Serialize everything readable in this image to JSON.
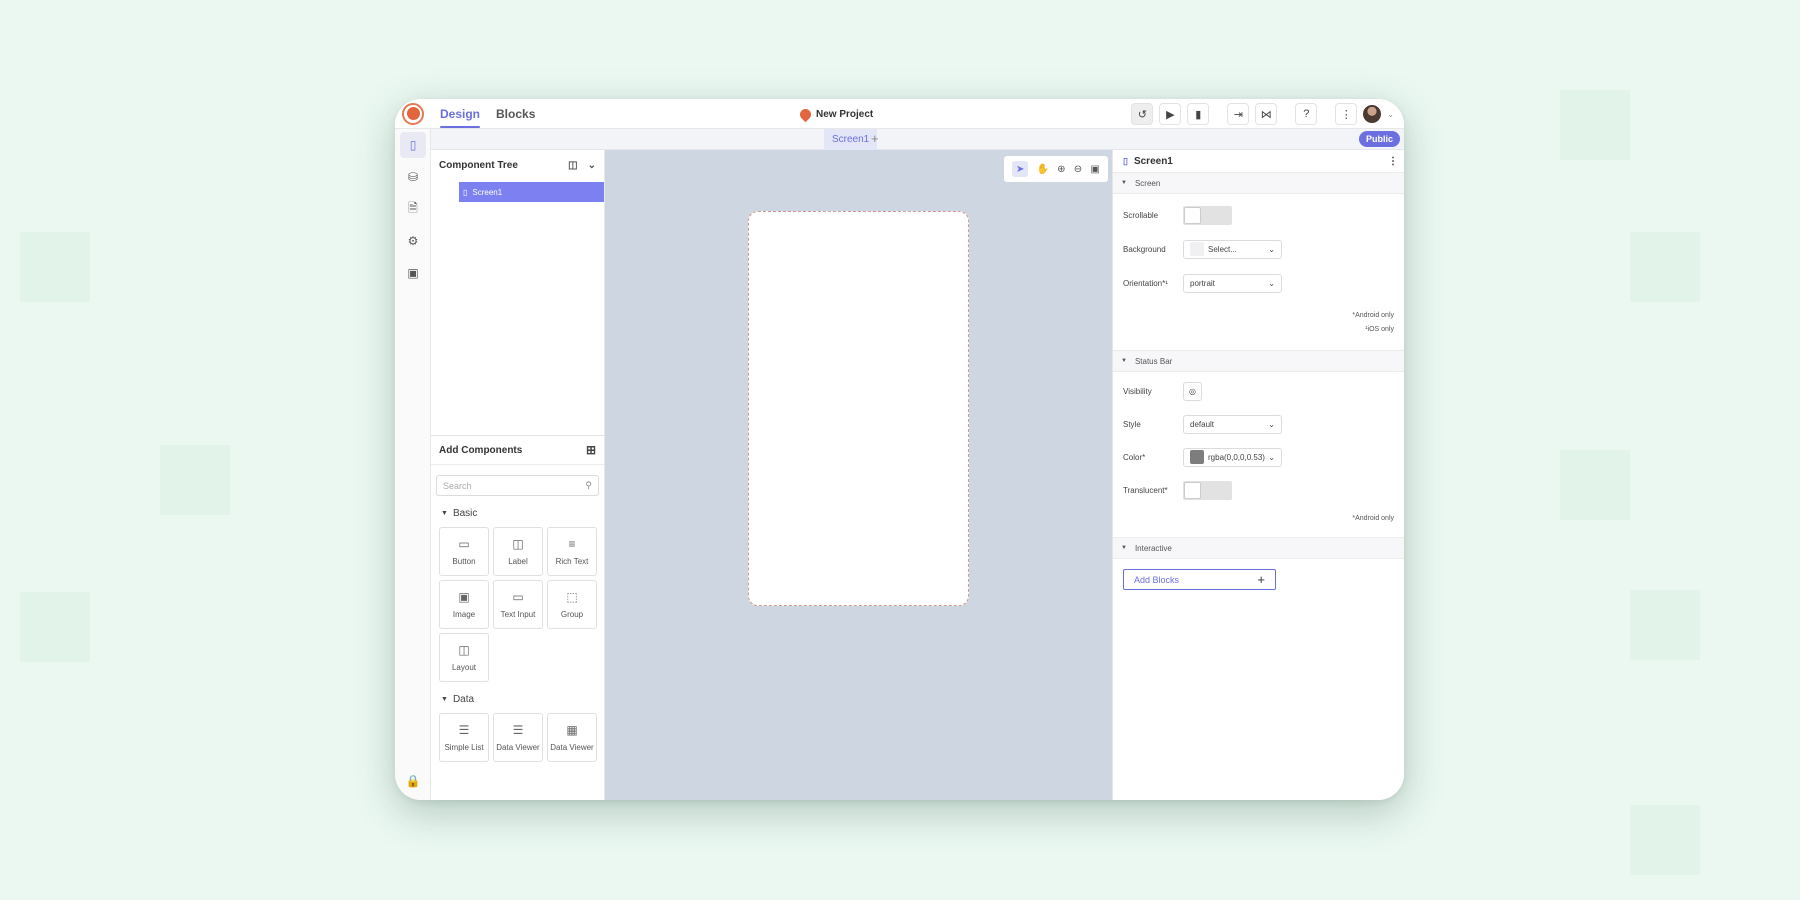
{
  "topbar": {
    "tabs": [
      {
        "label": "Design"
      },
      {
        "label": "Blocks"
      }
    ],
    "project_name": "New Project",
    "tool_icons": [
      "history-icon",
      "play-icon",
      "preview-icon",
      "export-icon",
      "share-icon",
      "help-icon",
      "more-icon"
    ]
  },
  "subbar": {
    "screen_tab": "Screen1",
    "add_tab": "+",
    "visibility_badge": "Public"
  },
  "rail": {
    "icons": [
      "screen-icon",
      "database-icon",
      "file-icon",
      "settings-icon",
      "ai-icon",
      "lock-icon"
    ]
  },
  "component_tree": {
    "title": "Component Tree",
    "items": [
      {
        "label": "Screen1"
      }
    ]
  },
  "add_components": {
    "title": "Add Components",
    "search_placeholder": "Search",
    "sections": [
      {
        "label": "Basic",
        "items": [
          {
            "label": "Button"
          },
          {
            "label": "Label"
          },
          {
            "label": "Rich Text"
          },
          {
            "label": "Image"
          },
          {
            "label": "Text Input"
          },
          {
            "label": "Group"
          },
          {
            "label": "Layout"
          }
        ]
      },
      {
        "label": "Data",
        "items": [
          {
            "label": "Simple List"
          },
          {
            "label": "Data Viewer"
          },
          {
            "label": "Data Viewer"
          }
        ]
      }
    ]
  },
  "properties": {
    "title": "Screen1",
    "sections": {
      "screen": {
        "label": "Screen",
        "scrollable_label": "Scrollable",
        "background_label": "Background",
        "background_value": "Select...",
        "orientation_label": "Orientation*¹",
        "orientation_value": "portrait",
        "note_android": "*Android only",
        "note_ios": "¹iOS only"
      },
      "status_bar": {
        "label": "Status Bar",
        "visibility_label": "Visibility",
        "style_label": "Style",
        "style_value": "default",
        "color_label": "Color*",
        "color_value": "rgba(0,0,0,0.53)",
        "translucent_label": "Translucent*",
        "note_android": "*Android only"
      },
      "interactive": {
        "label": "Interactive",
        "add_blocks_label": "Add Blocks",
        "add_blocks_plus": "+"
      }
    }
  },
  "colors": {
    "accent": "#6b6fe0",
    "canvas": "#cdd6e1",
    "background": "#eaf8f1"
  }
}
